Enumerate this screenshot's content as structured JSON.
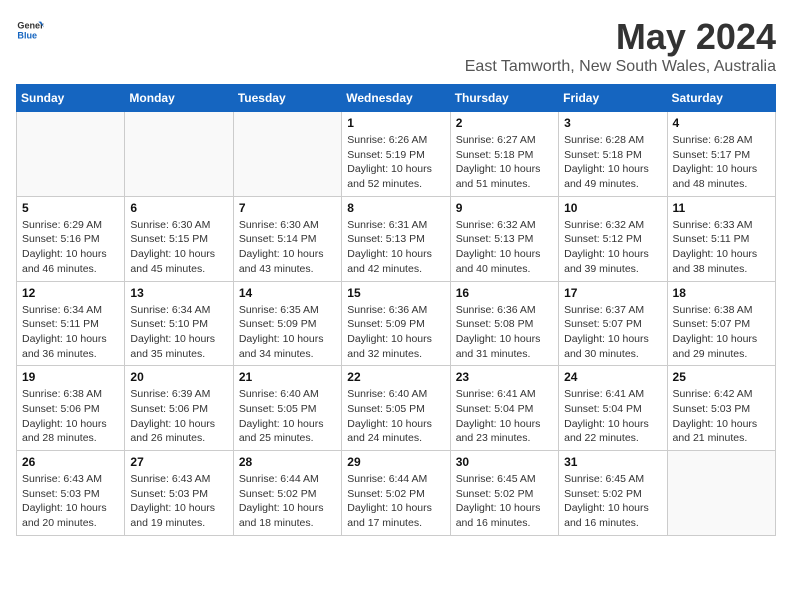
{
  "header": {
    "logo_general": "General",
    "logo_blue": "Blue",
    "main_title": "May 2024",
    "sub_title": "East Tamworth, New South Wales, Australia"
  },
  "days_of_week": [
    "Sunday",
    "Monday",
    "Tuesday",
    "Wednesday",
    "Thursday",
    "Friday",
    "Saturday"
  ],
  "weeks": [
    {
      "days": [
        {
          "number": "",
          "info": ""
        },
        {
          "number": "",
          "info": ""
        },
        {
          "number": "",
          "info": ""
        },
        {
          "number": "1",
          "info": "Sunrise: 6:26 AM\nSunset: 5:19 PM\nDaylight: 10 hours and 52 minutes."
        },
        {
          "number": "2",
          "info": "Sunrise: 6:27 AM\nSunset: 5:18 PM\nDaylight: 10 hours and 51 minutes."
        },
        {
          "number": "3",
          "info": "Sunrise: 6:28 AM\nSunset: 5:18 PM\nDaylight: 10 hours and 49 minutes."
        },
        {
          "number": "4",
          "info": "Sunrise: 6:28 AM\nSunset: 5:17 PM\nDaylight: 10 hours and 48 minutes."
        }
      ]
    },
    {
      "days": [
        {
          "number": "5",
          "info": "Sunrise: 6:29 AM\nSunset: 5:16 PM\nDaylight: 10 hours and 46 minutes."
        },
        {
          "number": "6",
          "info": "Sunrise: 6:30 AM\nSunset: 5:15 PM\nDaylight: 10 hours and 45 minutes."
        },
        {
          "number": "7",
          "info": "Sunrise: 6:30 AM\nSunset: 5:14 PM\nDaylight: 10 hours and 43 minutes."
        },
        {
          "number": "8",
          "info": "Sunrise: 6:31 AM\nSunset: 5:13 PM\nDaylight: 10 hours and 42 minutes."
        },
        {
          "number": "9",
          "info": "Sunrise: 6:32 AM\nSunset: 5:13 PM\nDaylight: 10 hours and 40 minutes."
        },
        {
          "number": "10",
          "info": "Sunrise: 6:32 AM\nSunset: 5:12 PM\nDaylight: 10 hours and 39 minutes."
        },
        {
          "number": "11",
          "info": "Sunrise: 6:33 AM\nSunset: 5:11 PM\nDaylight: 10 hours and 38 minutes."
        }
      ]
    },
    {
      "days": [
        {
          "number": "12",
          "info": "Sunrise: 6:34 AM\nSunset: 5:11 PM\nDaylight: 10 hours and 36 minutes."
        },
        {
          "number": "13",
          "info": "Sunrise: 6:34 AM\nSunset: 5:10 PM\nDaylight: 10 hours and 35 minutes."
        },
        {
          "number": "14",
          "info": "Sunrise: 6:35 AM\nSunset: 5:09 PM\nDaylight: 10 hours and 34 minutes."
        },
        {
          "number": "15",
          "info": "Sunrise: 6:36 AM\nSunset: 5:09 PM\nDaylight: 10 hours and 32 minutes."
        },
        {
          "number": "16",
          "info": "Sunrise: 6:36 AM\nSunset: 5:08 PM\nDaylight: 10 hours and 31 minutes."
        },
        {
          "number": "17",
          "info": "Sunrise: 6:37 AM\nSunset: 5:07 PM\nDaylight: 10 hours and 30 minutes."
        },
        {
          "number": "18",
          "info": "Sunrise: 6:38 AM\nSunset: 5:07 PM\nDaylight: 10 hours and 29 minutes."
        }
      ]
    },
    {
      "days": [
        {
          "number": "19",
          "info": "Sunrise: 6:38 AM\nSunset: 5:06 PM\nDaylight: 10 hours and 28 minutes."
        },
        {
          "number": "20",
          "info": "Sunrise: 6:39 AM\nSunset: 5:06 PM\nDaylight: 10 hours and 26 minutes."
        },
        {
          "number": "21",
          "info": "Sunrise: 6:40 AM\nSunset: 5:05 PM\nDaylight: 10 hours and 25 minutes."
        },
        {
          "number": "22",
          "info": "Sunrise: 6:40 AM\nSunset: 5:05 PM\nDaylight: 10 hours and 24 minutes."
        },
        {
          "number": "23",
          "info": "Sunrise: 6:41 AM\nSunset: 5:04 PM\nDaylight: 10 hours and 23 minutes."
        },
        {
          "number": "24",
          "info": "Sunrise: 6:41 AM\nSunset: 5:04 PM\nDaylight: 10 hours and 22 minutes."
        },
        {
          "number": "25",
          "info": "Sunrise: 6:42 AM\nSunset: 5:03 PM\nDaylight: 10 hours and 21 minutes."
        }
      ]
    },
    {
      "days": [
        {
          "number": "26",
          "info": "Sunrise: 6:43 AM\nSunset: 5:03 PM\nDaylight: 10 hours and 20 minutes."
        },
        {
          "number": "27",
          "info": "Sunrise: 6:43 AM\nSunset: 5:03 PM\nDaylight: 10 hours and 19 minutes."
        },
        {
          "number": "28",
          "info": "Sunrise: 6:44 AM\nSunset: 5:02 PM\nDaylight: 10 hours and 18 minutes."
        },
        {
          "number": "29",
          "info": "Sunrise: 6:44 AM\nSunset: 5:02 PM\nDaylight: 10 hours and 17 minutes."
        },
        {
          "number": "30",
          "info": "Sunrise: 6:45 AM\nSunset: 5:02 PM\nDaylight: 10 hours and 16 minutes."
        },
        {
          "number": "31",
          "info": "Sunrise: 6:45 AM\nSunset: 5:02 PM\nDaylight: 10 hours and 16 minutes."
        },
        {
          "number": "",
          "info": ""
        }
      ]
    }
  ]
}
